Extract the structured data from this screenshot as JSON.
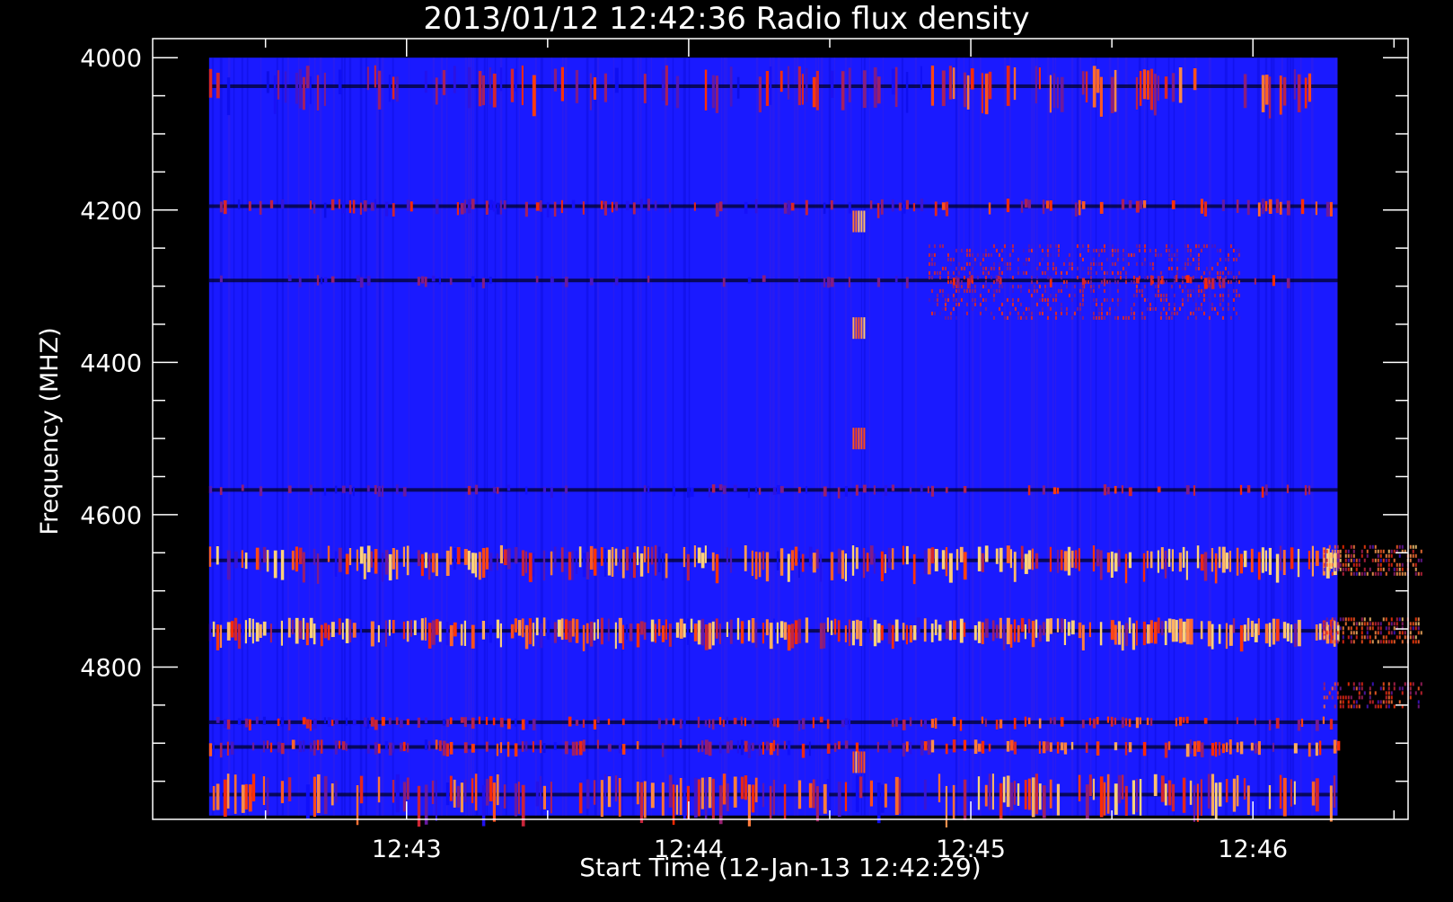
{
  "chart_data": {
    "type": "heatmap",
    "title": "2013/01/12 12:42:36 Radio flux density",
    "xlabel": "Start Time (12-Jan-13 12:42:29)",
    "ylabel": "Frequency (MHZ)",
    "x_ticks": [
      "12:43",
      "12:44",
      "12:45",
      "12:46"
    ],
    "x_tick_values_min": [
      43,
      44,
      45,
      46
    ],
    "x_range_min": [
      42.1,
      46.55
    ],
    "data_range_min": [
      42.3,
      46.3
    ],
    "y_ticks": [
      4000,
      4200,
      4400,
      4600,
      4800
    ],
    "y_range": [
      3975,
      5000
    ],
    "data_range_mhz": [
      4000,
      4995
    ],
    "colormap": [
      "#000000",
      "#1010ff",
      "#ff2a00",
      "#ffd27a"
    ],
    "background": "#000000",
    "frame_color": "#ffffff",
    "bands": [
      {
        "freq_start": 4010,
        "freq_end": 4065,
        "intensity": 0.45
      },
      {
        "freq_start": 4185,
        "freq_end": 4205,
        "intensity": 0.4
      },
      {
        "freq_start": 4285,
        "freq_end": 4300,
        "intensity": 0.25
      },
      {
        "freq_start": 4560,
        "freq_end": 4575,
        "intensity": 0.3
      },
      {
        "freq_start": 4640,
        "freq_end": 4680,
        "intensity": 0.85
      },
      {
        "freq_start": 4735,
        "freq_end": 4770,
        "intensity": 0.95
      },
      {
        "freq_start": 4865,
        "freq_end": 4880,
        "intensity": 0.45
      },
      {
        "freq_start": 4895,
        "freq_end": 4915,
        "intensity": 0.55
      },
      {
        "freq_start": 4940,
        "freq_end": 4995,
        "intensity": 0.65
      }
    ],
    "patches": [
      {
        "time_start": 44.85,
        "time_end": 45.95,
        "freq_start": 4245,
        "freq_end": 4345,
        "intensity": 0.5
      },
      {
        "time_start": 46.25,
        "time_end": 46.6,
        "freq_start": 4640,
        "freq_end": 4680,
        "intensity": 1.0
      },
      {
        "time_start": 46.25,
        "time_end": 46.6,
        "freq_start": 4735,
        "freq_end": 4770,
        "intensity": 1.0
      },
      {
        "time_start": 46.25,
        "time_end": 46.6,
        "freq_start": 4820,
        "freq_end": 4850,
        "intensity": 0.7
      }
    ],
    "bursts": [
      {
        "time": 44.6,
        "freq": 4215,
        "intensity": 0.9
      },
      {
        "time": 44.6,
        "freq": 4355,
        "intensity": 1.0
      },
      {
        "time": 44.6,
        "freq": 4500,
        "intensity": 0.8
      },
      {
        "time": 44.6,
        "freq": 4925,
        "intensity": 0.8
      }
    ],
    "grid": false
  }
}
